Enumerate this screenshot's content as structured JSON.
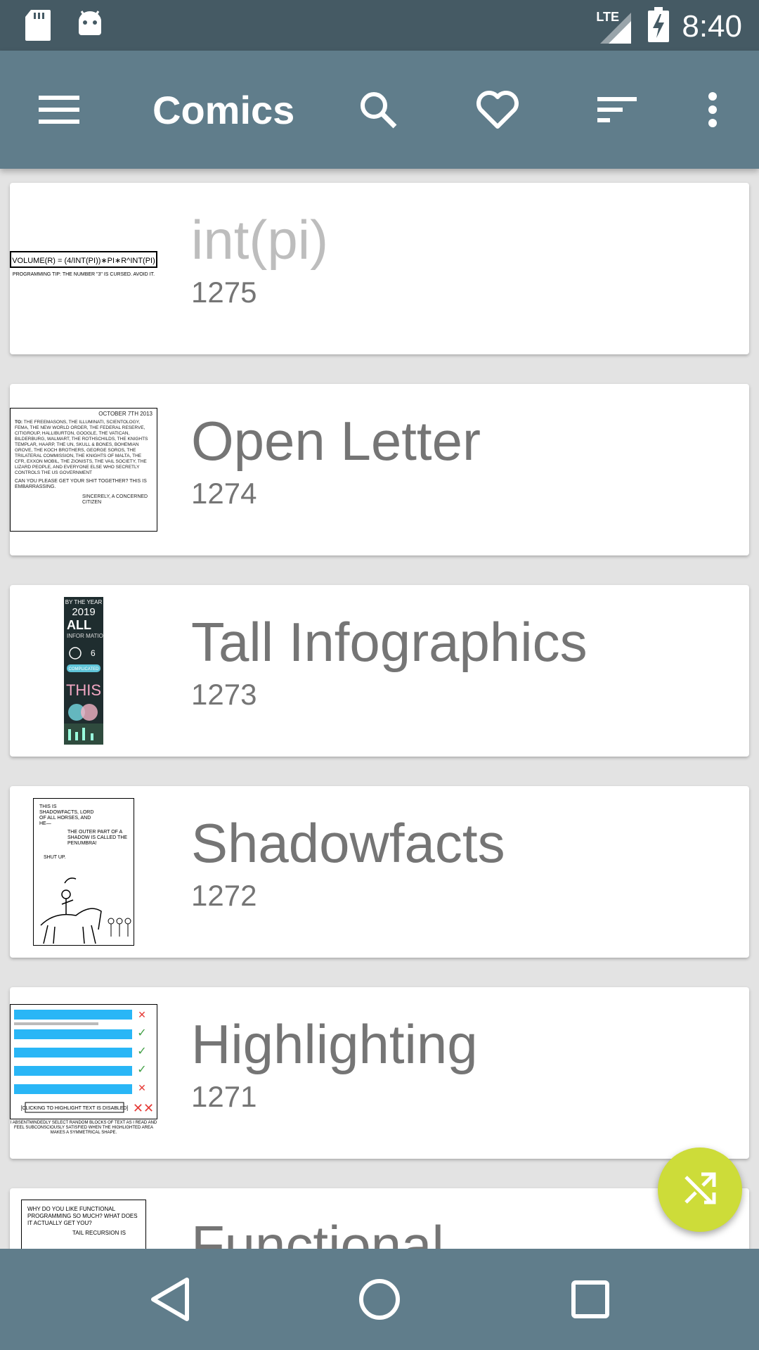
{
  "status_bar": {
    "network_label": "LTE",
    "time": "8:40",
    "icons": [
      "sd-card-icon",
      "android-icon",
      "signal-icon",
      "battery-charging-icon"
    ]
  },
  "toolbar": {
    "title": "Comics",
    "icons": [
      "menu-icon",
      "search-icon",
      "favorite-icon",
      "sort-icon",
      "more-vert-icon"
    ]
  },
  "comics": [
    {
      "title": "int(pi)",
      "number": "1275",
      "thumb": {
        "line1": "VOLUME(R) = (4/INT(PI))∗PI∗R^INT(PI)",
        "line2": "PROGRAMMING TIP: THE NUMBER \"3\" IS CURSED. AVOID IT."
      }
    },
    {
      "title": "Open Letter",
      "number": "1274",
      "thumb": {
        "date": "OCTOBER 7TH 2013",
        "to": "TO:",
        "body": "THE FREEMASONS, THE ILLUMINATI, SCIENTOLOGY, FEMA, THE NEW WORLD ORDER, THE FEDERAL RESERVE, CITIGROUP, HALLIBURTON, GOOGLE, THE VATICAN, BILDERBURG, WALMART, THE ROTHSCHILDS, THE KNIGHTS TEMPLAR, HAARP, THE UN, SKULL & BONES, BOHEMIAN GROVE, THE KOCH BROTHERS, GEORGE SOROS, THE TRILATERAL COMMISSION, THE KNIGHTS OF MALTA, THE CFR, EXXON MOBIL, THE ZIONISTS, THE VAIL SOCIETY, THE LIZARD PEOPLE, AND EVERYONE ELSE WHO SECRETLY CONTROLS THE US GOVERNMENT",
        "ask": "CAN YOU PLEASE GET YOUR SHIT TOGETHER? THIS IS EMBARRASSING.",
        "sign": "SINCERELY, A CONCERNED CITIZEN"
      }
    },
    {
      "title": "Tall Infographics",
      "number": "1273",
      "thumb": {
        "l1": "BY THE YEAR",
        "l2": "2019",
        "l3": "ALL",
        "l4": "INFOR MATION",
        "l5": "COMPLICATED",
        "l6": "THIS"
      }
    },
    {
      "title": "Shadowfacts",
      "number": "1272",
      "thumb": {
        "t1": "THIS IS SHADOWFACTS, LORD OF ALL HORSES, AND HE—",
        "t2": "THE OUTER PART OF A SHADOW IS CALLED THE PENUMBRA!",
        "t3": "SHUT UP."
      }
    },
    {
      "title": "Highlighting",
      "number": "1271",
      "thumb": {
        "btn": "[CLICKING TO HIGHLIGHT TEXT IS DISABLED]",
        "caption": "I ABSENTMINDEDLY SELECT RANDOM BLOCKS OF TEXT AS I READ AND FEEL SUBCONSCIOUSLY SATISFIED WHEN THE HIGHLIGHTED AREA MAKES A SYMMETRICAL SHAPE."
      }
    },
    {
      "title": "Functional",
      "number": "",
      "thumb": {
        "t1": "WHY DO YOU LIKE FUNCTIONAL PROGRAMMING SO MUCH? WHAT DOES IT ACTUALLY GET YOU?",
        "t2": "TAIL RECURSION IS"
      }
    }
  ],
  "colors": {
    "status_bar": "#455a64",
    "toolbar": "#607d8b",
    "fab": "#cddc39",
    "background": "#e3e3e3"
  },
  "fab": {
    "icon": "shuffle-icon"
  },
  "nav_bar": {
    "icons": [
      "back-icon",
      "home-icon",
      "recents-icon"
    ]
  }
}
